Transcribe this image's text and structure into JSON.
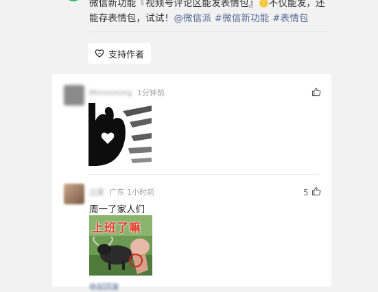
{
  "post": {
    "text_before_emoji": "微信新功能『视频号评论区能发表情包』",
    "text_after_emoji": "不仅能发，还能存表情包，试试！",
    "tags": [
      "@微信派",
      "#微信新功能",
      "#表情包"
    ]
  },
  "support_button": {
    "label": "支持作者",
    "icon": "heart-outline-icon"
  },
  "comments": [
    {
      "username": "Mimmmmg",
      "time": "1分钟前",
      "location": "",
      "like_count": "",
      "text": "",
      "image": "black-heart-hand-gesture-sticker"
    },
    {
      "username": "立夏",
      "location": "广东",
      "time": "1小时前",
      "like_count": "5",
      "text": "周一了家人们",
      "image": "cow-meme-sticker",
      "image_caption": "上班了嘛",
      "reply_link": "收起回复"
    }
  ],
  "colors": {
    "link": "#576b95",
    "meta": "#a0a0a0",
    "page_bg": "#f2f2f2",
    "meme_red": "#e23b2e"
  }
}
